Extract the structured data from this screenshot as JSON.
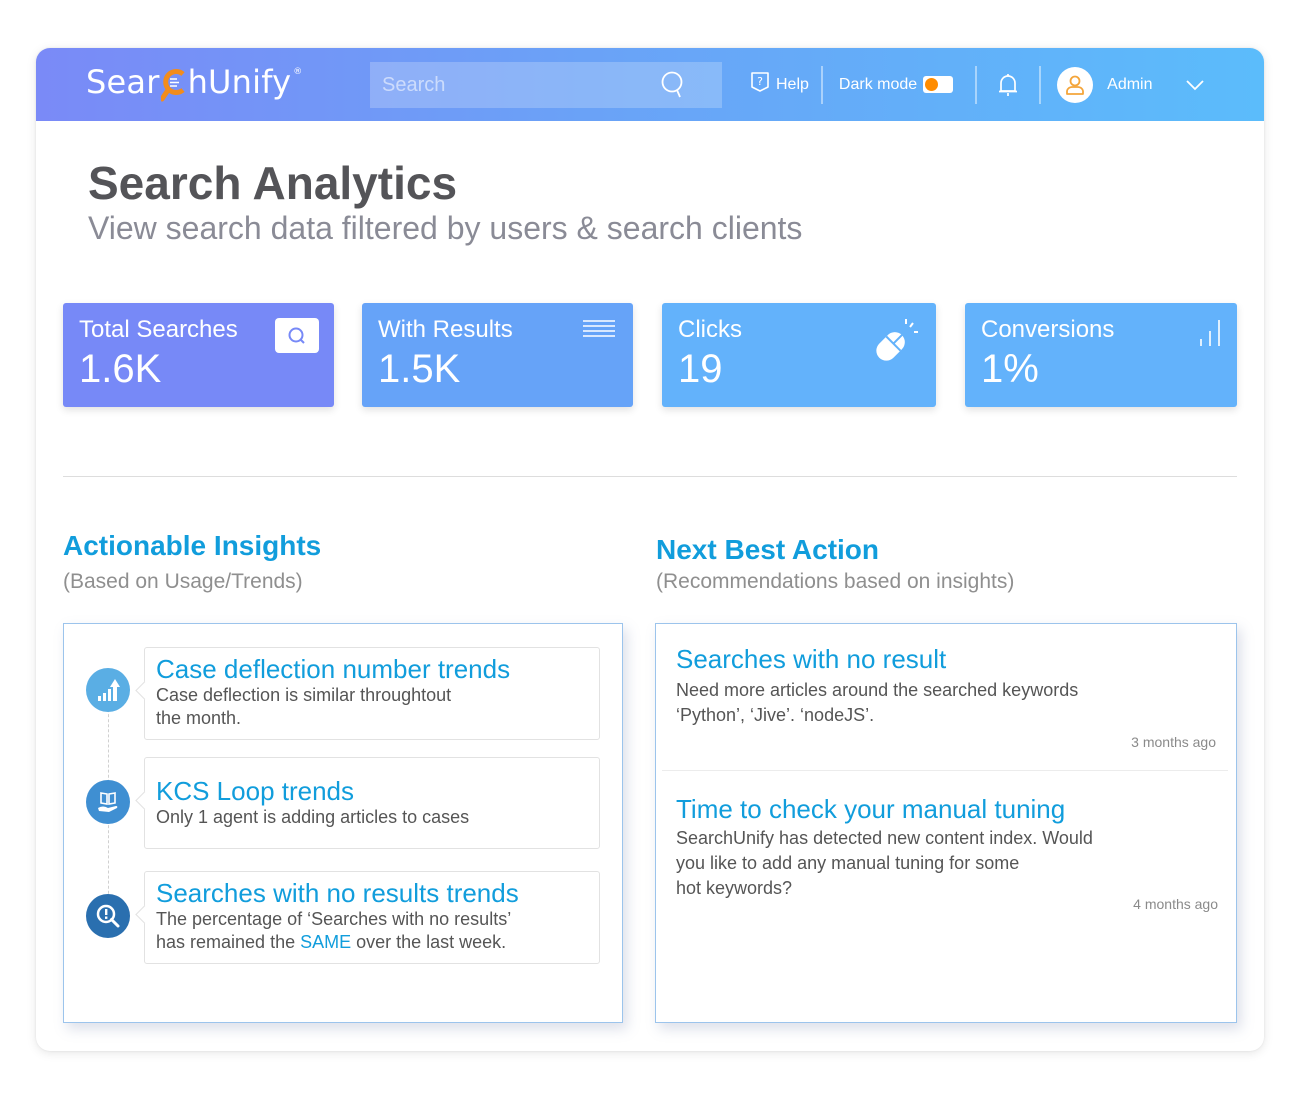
{
  "header": {
    "logo": {
      "prefix": "Sear",
      "suffix": "hUnify",
      "reg": "®"
    },
    "search": {
      "placeholder": "Search",
      "value": ""
    },
    "help_label": "Help",
    "dark_mode_label": "Dark mode",
    "dark_mode_on": false,
    "user_label": "Admin"
  },
  "page": {
    "title": "Search Analytics",
    "subtitle": "View search data filtered by users & search clients"
  },
  "stats": [
    {
      "label": "Total Searches",
      "value": "1.6K",
      "icon": "search-icon"
    },
    {
      "label": "With Results",
      "value": "1.5K",
      "icon": "list-lines-icon"
    },
    {
      "label": "Clicks",
      "value": "19",
      "icon": "mouse-click-icon"
    },
    {
      "label": "Conversions",
      "value": "1%",
      "icon": "bar-signal-icon"
    }
  ],
  "insights": {
    "title": "Actionable Insights",
    "subtitle": "(Based on Usage/Trends)",
    "items": [
      {
        "title": "Case deflection number trends",
        "desc_line1": "Case deflection is similar throughtout",
        "desc_line2": "the month.",
        "icon": "growth-chart-icon"
      },
      {
        "title": "KCS Loop trends",
        "desc_line1": "Only 1 agent is adding articles to cases",
        "icon": "book-hand-icon"
      },
      {
        "title": "Searches with no results trends",
        "desc_line1": "The percentage of ‘Searches with no results’",
        "desc_pre": "has remained the ",
        "desc_highlight": "SAME",
        "desc_post": " over the last week.",
        "icon": "search-alert-icon"
      }
    ]
  },
  "next_best_action": {
    "title": "Next Best Action",
    "subtitle": "(Recommendations based on insights)",
    "items": [
      {
        "title": "Searches with no result",
        "desc_line1": "Need more articles around the searched keywords",
        "desc_line2": "‘Python’, ‘Jive’. ‘nodeJS’.",
        "time": "3 months ago"
      },
      {
        "title": "Time to check your manual tuning",
        "desc_line1": "SearchUnify has detected new content index. Would",
        "desc_line2": "you like to add any manual tuning for some",
        "desc_line3": "hot keywords?",
        "time": "4 months ago"
      }
    ]
  },
  "colors": {
    "accent": "#119ddc",
    "card_total": "#7789f7",
    "card_results": "#66a3f8",
    "card_clicks": "#63b2fb",
    "card_conversions": "#63b2fb",
    "logo_orange": "#f28c1c"
  }
}
